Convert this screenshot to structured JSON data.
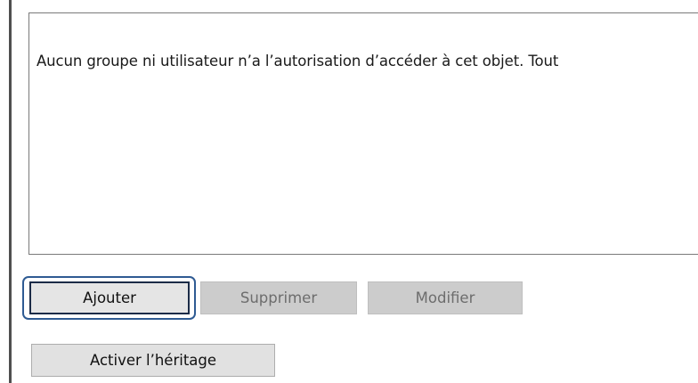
{
  "permissions": {
    "empty_message": "Aucun groupe ni utilisateur n’a l’autorisation d’accéder à cet objet. Tout"
  },
  "buttons": {
    "add_label": "Ajouter",
    "remove_label": "Supprimer",
    "edit_label": "Modifier",
    "enable_inheritance_label": "Activer l’héritage"
  },
  "colors": {
    "focus_ring": "#2f5b93",
    "button_face": "#e1e1e1",
    "disabled_button_face": "#cccccc",
    "disabled_text": "#6d6d6d"
  }
}
